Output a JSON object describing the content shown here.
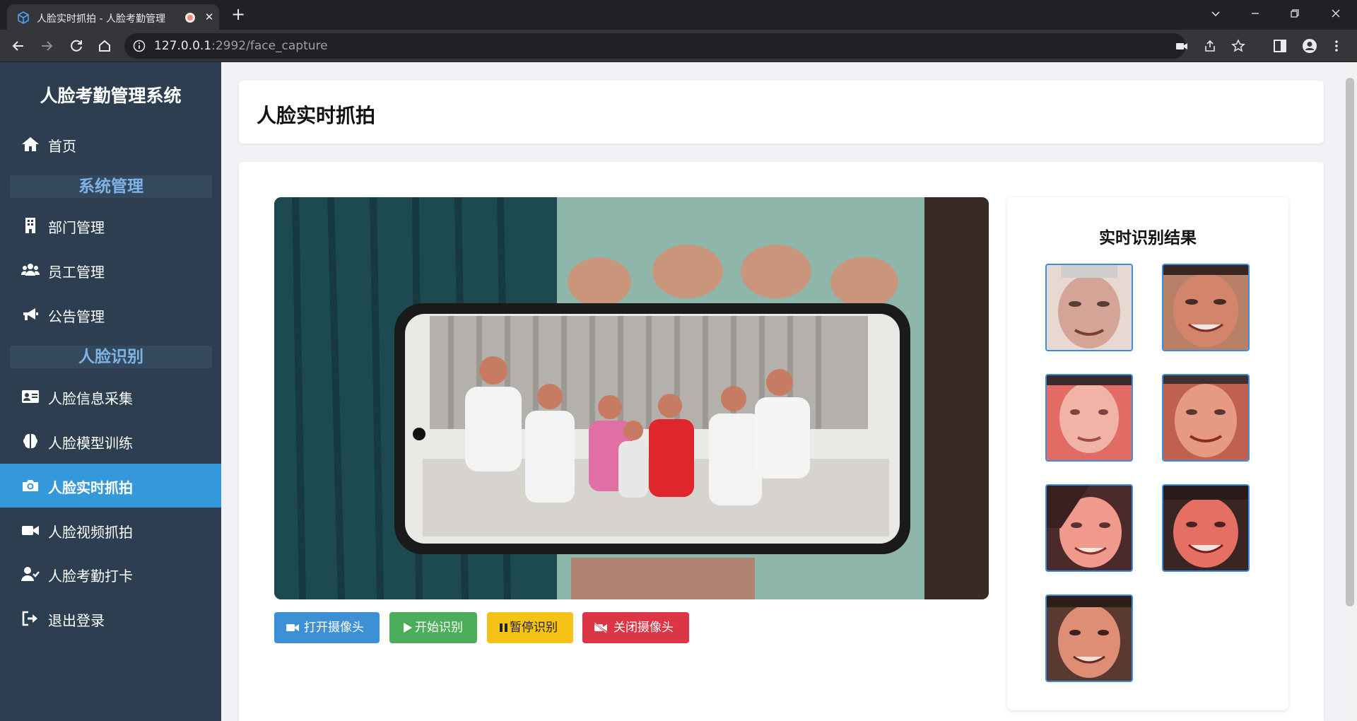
{
  "browser": {
    "tab_title": "人脸实时抓拍 - 人脸考勤管理",
    "url_host": "127.0.0.1",
    "url_path": ":2992/face_capture"
  },
  "sidebar": {
    "brand": "人脸考勤管理系统",
    "home": "首页",
    "section_system": "系统管理",
    "dept": "部门管理",
    "employee": "员工管理",
    "notice": "公告管理",
    "section_face": "人脸识别",
    "face_collect": "人脸信息采集",
    "face_train": "人脸模型训练",
    "face_capture": "人脸实时抓拍",
    "face_video": "人脸视频抓拍",
    "face_attend": "人脸考勤打卡",
    "logout": "退出登录"
  },
  "page": {
    "title": "人脸实时抓拍"
  },
  "controls": {
    "open_camera": "打开摄像头",
    "start": "开始识别",
    "pause": "暂停识别",
    "close_camera": "关闭摄像头"
  },
  "results": {
    "title": "实时识别结果",
    "face_count": 7
  },
  "colors": {
    "sidebar_bg": "#2c3e50",
    "active_item": "#3498db",
    "btn_open": "#3d8fd6",
    "btn_start": "#4cae5b",
    "btn_pause": "#f5c216",
    "btn_close": "#dc3545"
  }
}
